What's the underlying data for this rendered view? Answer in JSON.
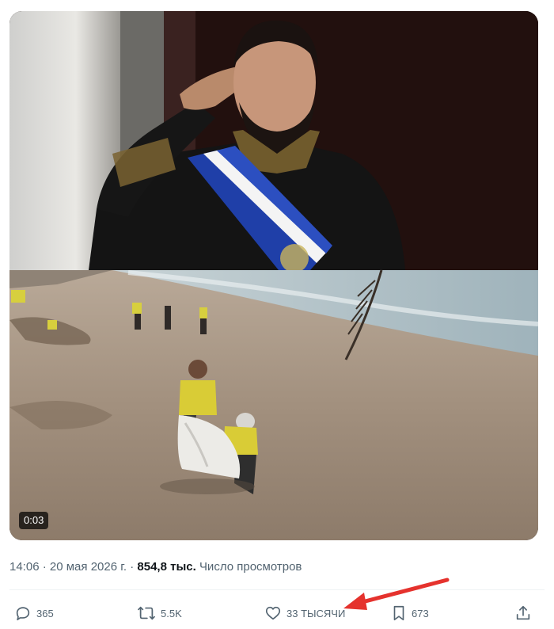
{
  "media": {
    "duration": "0:03"
  },
  "meta": {
    "time": "14:06",
    "separator": "·",
    "date": "20 мая 2026 г.",
    "views_count": "854,8 тыс.",
    "views_label": "Число просмотров"
  },
  "actions": {
    "replies": "365",
    "reposts": "5.5K",
    "likes": "33 ТЫСЯЧИ",
    "bookmarks": "673"
  },
  "colors": {
    "text_secondary": "#536471",
    "annotation_arrow": "#e5322d"
  }
}
